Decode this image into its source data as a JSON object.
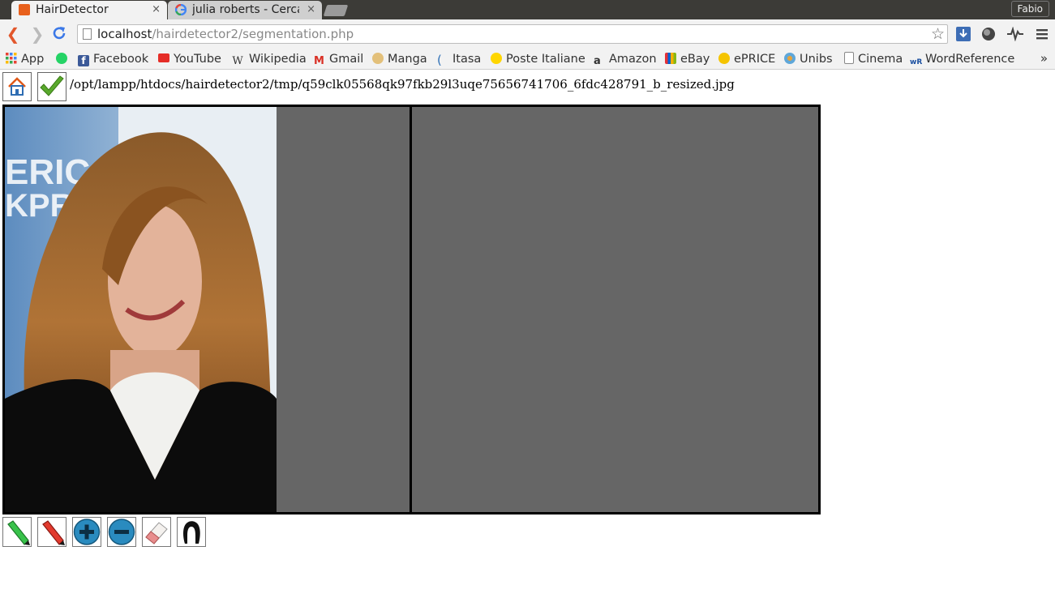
{
  "browser": {
    "tabs": [
      {
        "title": "HairDetector",
        "active": true,
        "close": "×"
      },
      {
        "title": "julia roberts - Cerca con Google",
        "active": false,
        "close": "×"
      }
    ],
    "user": "Fabio",
    "url_host": "localhost",
    "url_path": "/hairdetector2/segmentation.php",
    "bookmarks": [
      "App",
      "Facebook",
      "YouTube",
      "Wikipedia",
      "Gmail",
      "Manga",
      "Itasa",
      "Poste Italiane",
      "Amazon",
      "eBay",
      "ePRICE",
      "Unibs",
      "Cinema",
      "WordReference"
    ],
    "bookmarks_overflow": "»"
  },
  "page": {
    "file_path": "/opt/lampp/htdocs/hairdetector2/tmp/q59clk05568qk97fkb29l3uqe75656741706_6fdc428791_b_resized.jpg",
    "top_buttons": [
      "home-icon",
      "checkmark-icon"
    ],
    "tools": [
      "green-pencil-icon",
      "red-pencil-icon",
      "zoom-in-icon",
      "zoom-out-icon",
      "eraser-icon",
      "hair-silhouette-icon"
    ],
    "colors": {
      "canvas_bg": "#666666",
      "border": "#000000"
    }
  }
}
